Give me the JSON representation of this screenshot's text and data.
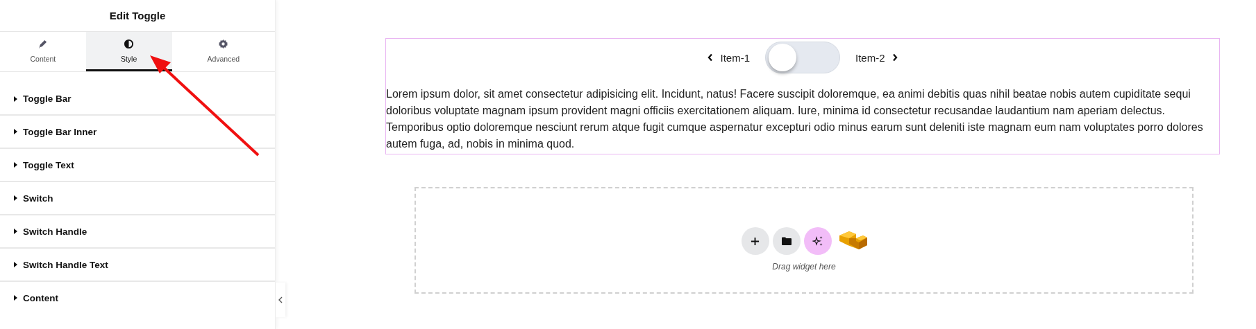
{
  "panel": {
    "title": "Edit Toggle",
    "tabs": [
      {
        "label": "Content",
        "selected": false
      },
      {
        "label": "Style",
        "selected": true
      },
      {
        "label": "Advanced",
        "selected": false
      }
    ],
    "sections": [
      {
        "label": "Toggle Bar",
        "expanded": false
      },
      {
        "label": "Toggle Bar Inner",
        "expanded": false
      },
      {
        "label": "Toggle Text",
        "expanded": false
      },
      {
        "label": "Switch",
        "expanded": false
      },
      {
        "label": "Switch Handle",
        "expanded": false
      },
      {
        "label": "Switch Handle Text",
        "expanded": false
      },
      {
        "label": "Content",
        "expanded": false
      }
    ]
  },
  "canvas": {
    "toggle": {
      "left_label": "Item-1",
      "right_label": "Item-2",
      "on": false
    },
    "paragraph": "Lorem ipsum dolor, sit amet consectetur adipisicing elit. Incidunt, natus! Facere suscipit doloremque, ea animi debitis quas nihil beatae nobis autem cupiditate sequi doloribus voluptate magnam ipsum provident magni officiis exercitationem aliquam. Iure, minima id consectetur recusandae laudantium nam aperiam delectus. Temporibus optio doloremque nesciunt rerum atque fugit cumque aspernatur excepturi odio minus earum sunt deleniti iste magnam eum nam voluptates porro dolores autem fuga, ad, nobis in minima quod.",
    "drop_zone": {
      "hint": "Drag widget here"
    }
  }
}
